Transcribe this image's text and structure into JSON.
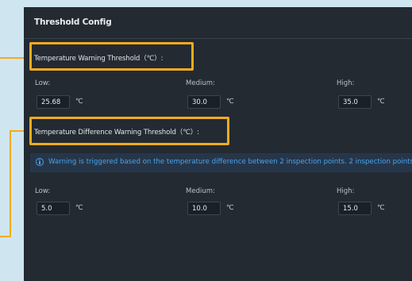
{
  "panel": {
    "title": "Threshold Config"
  },
  "temperature_warning": {
    "title": "Temperature Warning Threshold（℃）:",
    "low": {
      "label": "Low:",
      "value": "25.68",
      "unit": "℃"
    },
    "medium": {
      "label": "Medium:",
      "value": "30.0",
      "unit": "℃"
    },
    "high": {
      "label": "High:",
      "value": "35.0",
      "unit": "℃"
    }
  },
  "temperature_difference_warning": {
    "title": "Temperature Difference Warning Threshold（℃）:",
    "info": "Warning is triggered based on the temperature difference between 2 inspection points. 2 inspection points",
    "low": {
      "label": "Low:",
      "value": "5.0",
      "unit": "℃"
    },
    "medium": {
      "label": "Medium:",
      "value": "10.0",
      "unit": "℃"
    },
    "high": {
      "label": "High:",
      "value": "15.0",
      "unit": "℃"
    }
  },
  "colors": {
    "highlight": "#f2ab1f",
    "info_accent": "#4aa3ea",
    "panel_bg": "#232a32"
  },
  "icons": {
    "info": "info-circle-icon"
  }
}
